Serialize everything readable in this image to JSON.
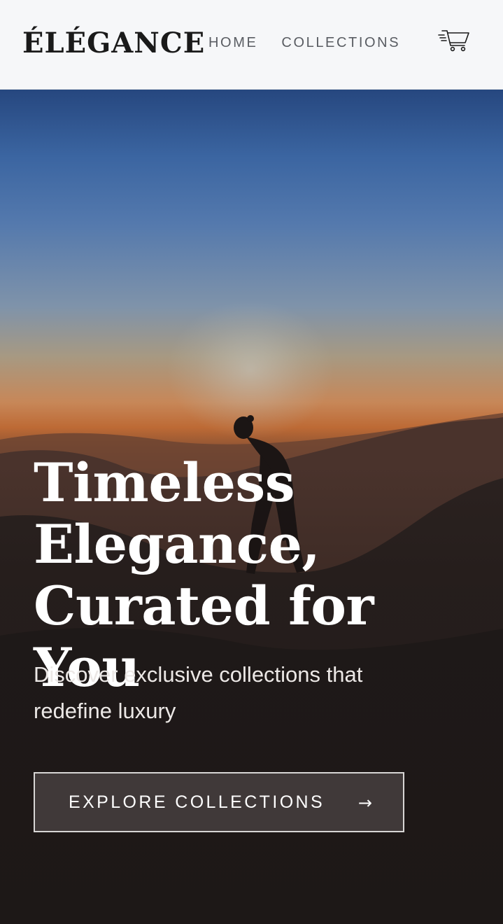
{
  "header": {
    "logo": "ÉLÉGANCE",
    "nav": [
      {
        "label": "HOME"
      },
      {
        "label": "COLLECTIONS"
      }
    ],
    "cart_icon": "shopping-cart-icon"
  },
  "hero": {
    "title_lines": [
      "Timeless",
      "Elegance,",
      "Curated for You"
    ],
    "subtitle_lines": [
      "Discover exclusive collections that",
      "redefine luxury"
    ],
    "cta": {
      "label": "EXPLORE COLLECTIONS",
      "arrow": "→"
    },
    "image_subject": "silhouette-on-mountain-at-sunset"
  },
  "colors": {
    "header_bg": "#f6f7f9",
    "logo_text": "#1a1a1a",
    "nav_text": "#5a5d63",
    "hero_text": "#ffffff",
    "cta_border": "#d8d6d5",
    "sky_top": "#26477f",
    "sunset_orange": "#c78758"
  }
}
